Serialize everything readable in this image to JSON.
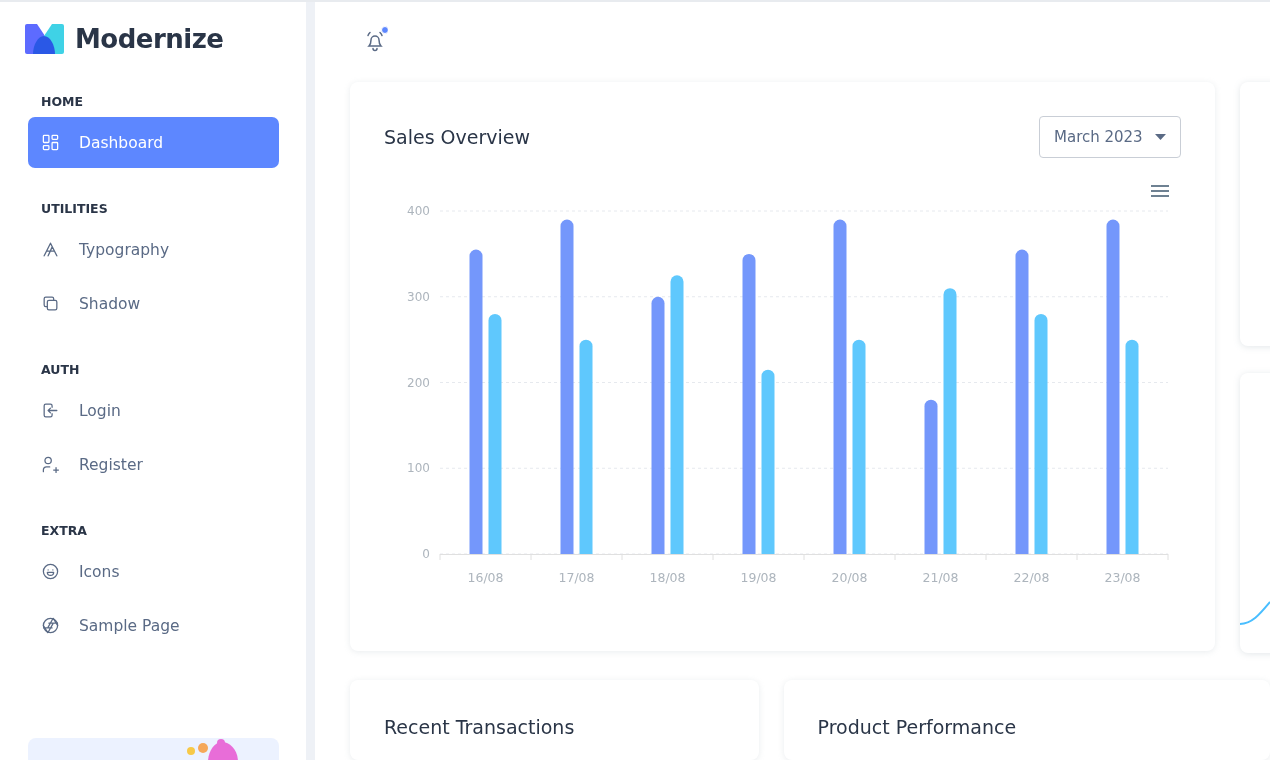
{
  "sidebar": {
    "logo": "Modernize",
    "sections": [
      {
        "title": "HOME",
        "items": [
          {
            "label": "Dashboard",
            "selected": true
          }
        ]
      },
      {
        "title": "UTILITIES",
        "items": [
          {
            "label": "Typography",
            "selected": false
          },
          {
            "label": "Shadow",
            "selected": false
          }
        ]
      },
      {
        "title": "AUTH",
        "items": [
          {
            "label": "Login",
            "selected": false
          },
          {
            "label": "Register",
            "selected": false
          }
        ]
      },
      {
        "title": "EXTRA",
        "items": [
          {
            "label": "Icons",
            "selected": false
          },
          {
            "label": "Sample Page",
            "selected": false
          }
        ]
      }
    ]
  },
  "sales_overview": {
    "title": "Sales Overview",
    "period_select": {
      "value": "March 2023"
    },
    "chart_data": {
      "type": "bar",
      "grid": true,
      "categories": [
        "16/08",
        "17/08",
        "18/08",
        "19/08",
        "20/08",
        "21/08",
        "22/08",
        "23/08"
      ],
      "ylim": [
        0,
        400
      ],
      "yticks": [
        0,
        100,
        200,
        300,
        400
      ],
      "series": [
        {
          "color": "#7497fb",
          "values": [
            355,
            390,
            300,
            350,
            390,
            180,
            355,
            390
          ]
        },
        {
          "color": "#5fc8fd",
          "values": [
            280,
            250,
            325,
            215,
            250,
            310,
            280,
            250
          ]
        }
      ]
    }
  },
  "cards": [
    {
      "title": "Recent Transactions"
    },
    {
      "title": "Product Performance"
    }
  ]
}
